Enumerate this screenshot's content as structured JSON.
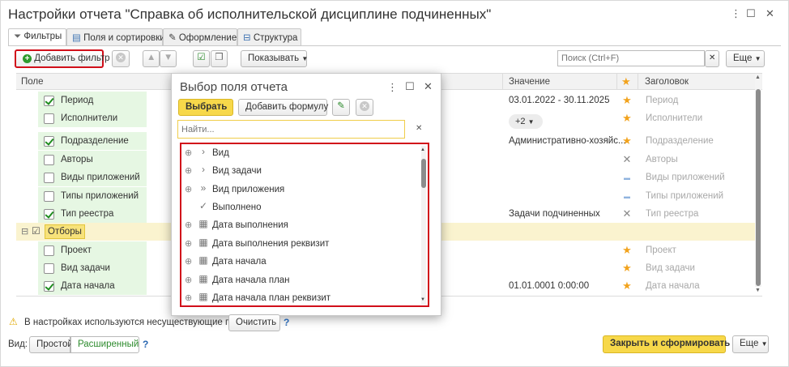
{
  "window": {
    "title": "Настройки отчета \"Справка об исполнительской дисциплине подчиненных\"",
    "more_icon": "⋮",
    "maximize_icon": "☐",
    "close_icon": "✕"
  },
  "tabs": [
    {
      "label": "Фильтры",
      "icon": "filter-icon"
    },
    {
      "label": "Поля и сортировки",
      "icon": "fields-icon"
    },
    {
      "label": "Оформление",
      "icon": "brush-icon"
    },
    {
      "label": "Структура",
      "icon": "structure-icon"
    }
  ],
  "toolbar": {
    "add_filter": "Добавить фильтр",
    "show": "Показывать",
    "search_placeholder": "Поиск (Ctrl+F)",
    "more": "Еще"
  },
  "table": {
    "columns": {
      "field": "Поле",
      "value": "Значение",
      "title": "Заголовок"
    },
    "rows": [
      {
        "label": "Период",
        "checked": true,
        "value": "03.01.2022 - 30.11.2025",
        "star": "★",
        "star_type": "star",
        "title": "Период"
      },
      {
        "label": "Исполнители",
        "checked": false,
        "value": "+2",
        "star": "★",
        "star_type": "star",
        "title": "Исполнители"
      },
      {
        "label": "Подразделение",
        "checked": true,
        "value": "Административно-хозяйс...",
        "star": "★",
        "star_type": "star",
        "title": "Подразделение"
      },
      {
        "label": "Авторы",
        "checked": false,
        "value": "",
        "star": "✕",
        "star_type": "cross",
        "title": "Авторы"
      },
      {
        "label": "Виды приложений",
        "checked": false,
        "value": "",
        "star": "▬",
        "star_type": "dash",
        "title": "Виды приложений"
      },
      {
        "label": "Типы приложений",
        "checked": false,
        "value": "",
        "star": "▬",
        "star_type": "dash",
        "title": "Типы приложений"
      },
      {
        "label": "Тип реестра",
        "checked": true,
        "value": "Задачи подчиненных",
        "star": "✕",
        "star_type": "cross",
        "title": "Тип реестра"
      },
      {
        "label": "Проект",
        "checked": false,
        "value": "",
        "star": "★",
        "star_type": "star",
        "title": "Проект"
      },
      {
        "label": "Вид задачи",
        "checked": false,
        "value": "",
        "star": "★",
        "star_type": "star",
        "title": "Вид задачи"
      },
      {
        "label": "Дата начала",
        "checked": true,
        "value": "01.01.0001 0:00:00",
        "star": "★",
        "star_type": "star",
        "title": "Дата начала"
      }
    ],
    "group_label": "Отборы"
  },
  "dialog": {
    "title": "Выбор поля отчета",
    "select": "Выбрать",
    "add_formula": "Добавить формулу",
    "search_placeholder": "Найти...",
    "items": [
      {
        "label": "Вид",
        "kind": "›"
      },
      {
        "label": "Вид задачи",
        "kind": "›"
      },
      {
        "label": "Вид приложения",
        "kind": "»"
      },
      {
        "label": "Выполнено",
        "kind": "✓"
      },
      {
        "label": "Дата выполнения",
        "kind": "cal"
      },
      {
        "label": "Дата выполнения реквизит",
        "kind": "cal"
      },
      {
        "label": "Дата начала",
        "kind": "cal"
      },
      {
        "label": "Дата начала план",
        "kind": "cal"
      },
      {
        "label": "Дата начала план реквизит",
        "kind": "cal"
      }
    ]
  },
  "footer": {
    "warning": "В настройках используются несуществующие поля.",
    "clear": "Очистить",
    "view_label": "Вид:",
    "view_simple": "Простой",
    "view_extended": "Расширенный",
    "close_and_build": "Закрыть и сформировать",
    "more": "Еще",
    "help": "?"
  },
  "colors": {
    "accent_yellow": "#f7d84a",
    "green_bg": "#e6f7e3",
    "red_highlight": "#d10f1a",
    "star": "#f2a31d"
  }
}
